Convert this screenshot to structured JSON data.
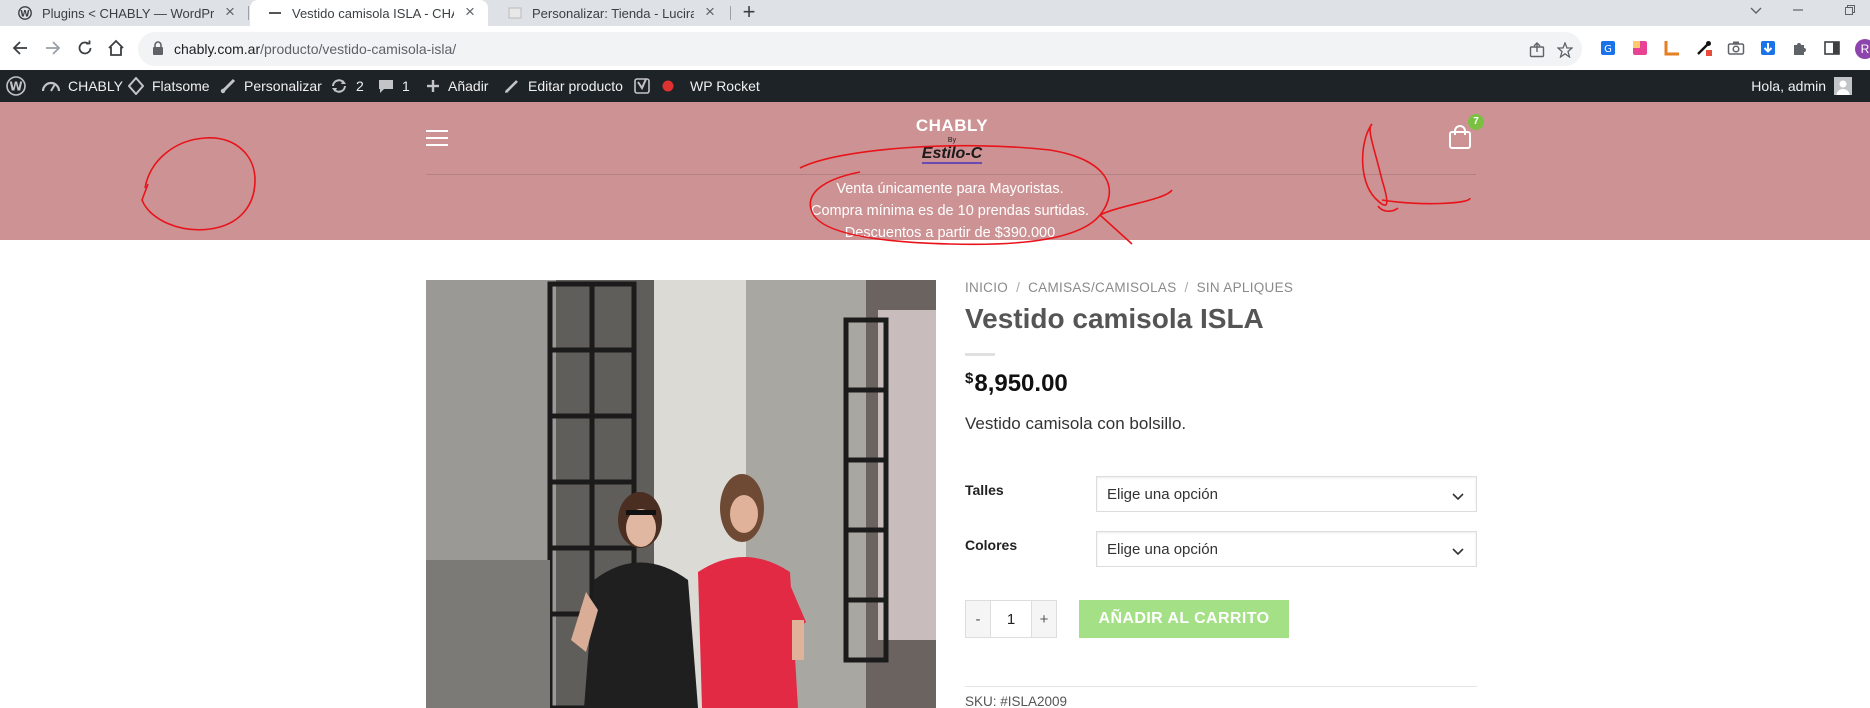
{
  "browser": {
    "tabs": [
      {
        "title": "Plugins < CHABLY — WordPress",
        "active": false
      },
      {
        "title": "Vestido camisola ISLA - CHABLY",
        "active": true
      },
      {
        "title": "Personalizar: Tienda - Luciras Kid",
        "active": false
      }
    ],
    "newtab_label": "+",
    "close_glyph": "×",
    "url_host": "chably.com.ar",
    "url_path": "/producto/vestido-camisola-isla/",
    "profile_initial": "R"
  },
  "adminbar": {
    "site_name": "CHABLY",
    "theme": "Flatsome",
    "customize": "Personalizar",
    "updates_count": "2",
    "comments_count": "1",
    "add_new": "Añadir",
    "edit_product": "Editar producto",
    "wp_rocket": "WP Rocket",
    "greeting": "Hola, admin"
  },
  "header": {
    "logo_main": "CHABLY",
    "logo_by": "By",
    "logo_sub": "Estilo-C",
    "cart_count": "7",
    "promo_lines": [
      "Venta únicamente para Mayoristas.",
      "Compra mínima es de 10 prendas surtidas.",
      "Descuentos a partir de $390.000"
    ],
    "bg_color": "#cd9294"
  },
  "product": {
    "breadcrumb": [
      "INICIO",
      "CAMISAS/CAMISOLAS",
      "SIN APLIQUES"
    ],
    "breadcrumb_sep": "/",
    "title": "Vestido camisola ISLA",
    "price_currency": "$",
    "price": "8,950.00",
    "short_description": "Vestido camisola con bolsillo.",
    "variations": [
      {
        "label": "Talles",
        "placeholder": "Elige una opción"
      },
      {
        "label": "Colores",
        "placeholder": "Elige una opción"
      }
    ],
    "quantity": "1",
    "qty_minus": "-",
    "qty_plus": "+",
    "add_to_cart": "AÑADIR AL CARRITO",
    "sku": "SKU: #ISLA2009",
    "accent_color": "#a4e086"
  }
}
